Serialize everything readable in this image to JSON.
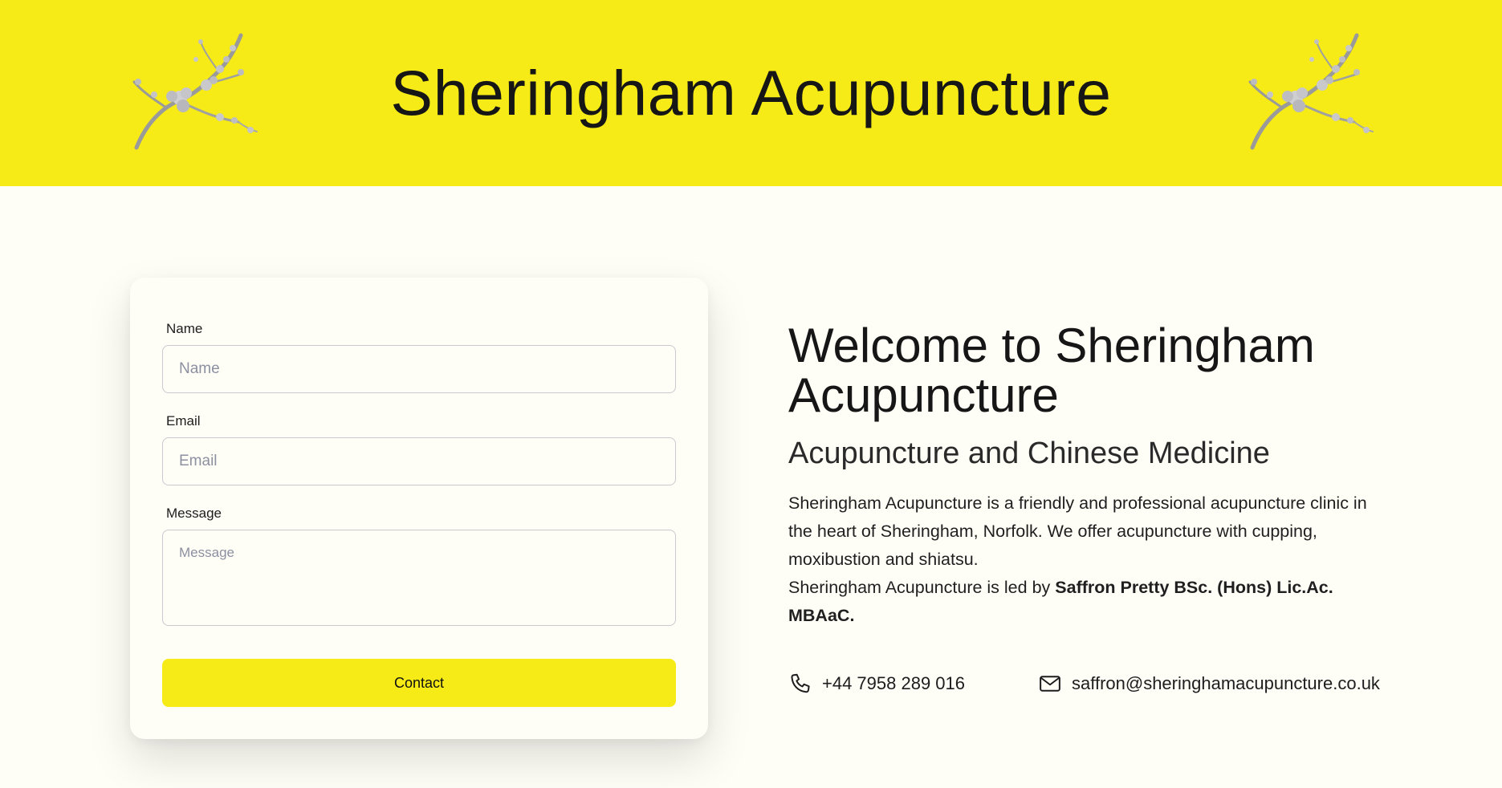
{
  "header": {
    "title": "Sheringham Acupuncture",
    "background_color": "#f6eb16",
    "decoration": "cherry-blossom-branch"
  },
  "contact_form": {
    "name_label": "Name",
    "name_placeholder": "Name",
    "email_label": "Email",
    "email_placeholder": "Email",
    "message_label": "Message",
    "message_placeholder": "Message",
    "submit_label": "Contact"
  },
  "welcome": {
    "heading": "Welcome to Sheringham Acupuncture",
    "subtitle": "Acupuncture and Chinese Medicine",
    "intro_text": "Sheringham Acupuncture is a friendly and professional acupuncture clinic in the heart of Sheringham, Norfolk. We offer acupuncture with cupping, moxibustion and shiatsu.",
    "led_by_text": "Sheringham Acupuncture is led by ",
    "practitioner": "Saffron Pretty BSc. (Hons) Lic.Ac. MBAaC."
  },
  "contact_info": {
    "phone_icon": "phone-icon",
    "phone": "+44 7958 289 016",
    "email_icon": "mail-icon",
    "email": "saffron@sheringhamacupuncture.co.uk"
  },
  "colors": {
    "accent": "#f6eb16",
    "page_background": "#fefdf6"
  }
}
